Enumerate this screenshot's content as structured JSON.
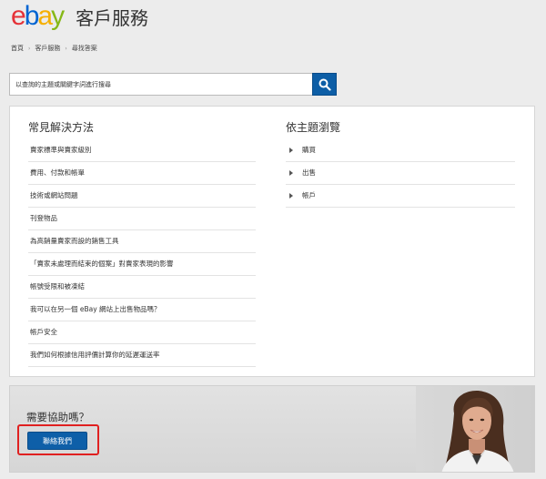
{
  "brand": {
    "logo_letters": [
      {
        "char": "e",
        "color": "#e53238"
      },
      {
        "char": "b",
        "color": "#0064d2"
      },
      {
        "char": "a",
        "color": "#f5af02"
      },
      {
        "char": "y",
        "color": "#86b817"
      }
    ],
    "page_title": "客戶服務"
  },
  "breadcrumb": [
    "首頁",
    "客戶服務",
    "尋找答案"
  ],
  "search": {
    "placeholder": "以查詢的主題或關鍵字詞進行搜尋",
    "value": ""
  },
  "common_solutions": {
    "title": "常見解決方法",
    "items": [
      "賣家標準與賣家級別",
      "費用、付款和帳單",
      "技術或網站問題",
      "刊登物品",
      "為高銷量賣家而設的銷售工具",
      "「賣家未處理而結束的個案」對賣家表現的影響",
      "帳號受限和被凍結",
      "我可以在另一個 eBay 網站上出售物品嗎？",
      "帳戶安全",
      "我們如何根據信用評價計算你的延遲運送率"
    ]
  },
  "topics": {
    "title": "依主題瀏覽",
    "items": [
      "購買",
      "出售",
      "帳戶"
    ]
  },
  "help": {
    "title": "需要協助嗎？",
    "contact_label": "聯絡我們"
  },
  "colors": {
    "accent": "#0e5fa8",
    "highlight_border": "#e02020"
  }
}
